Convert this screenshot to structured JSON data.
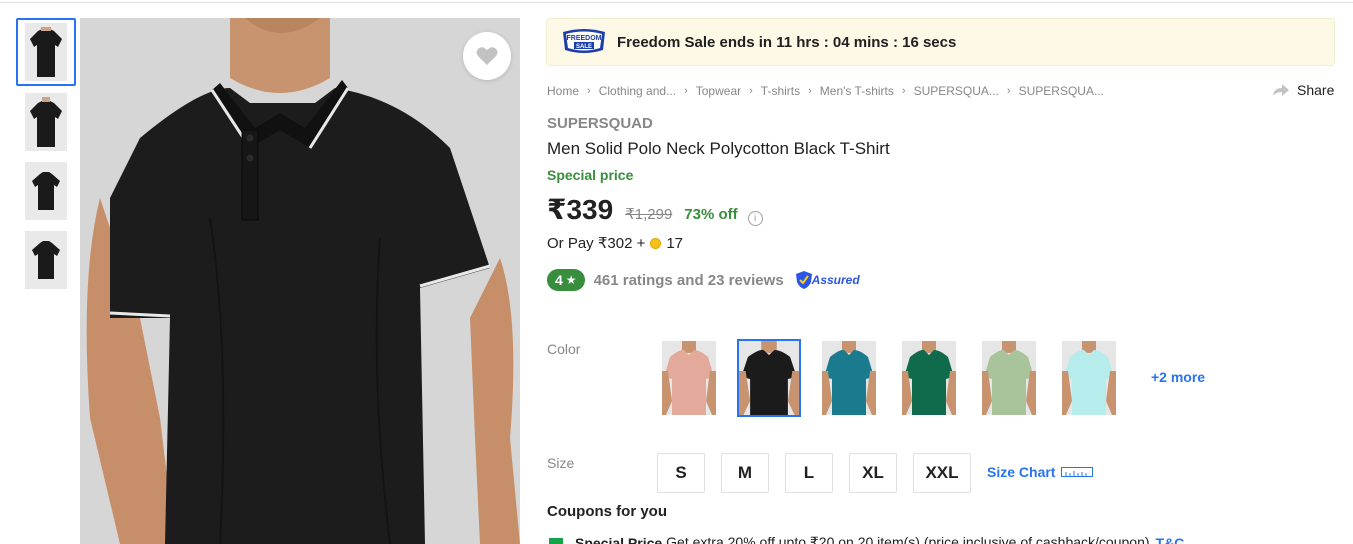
{
  "sale": {
    "logo_line1": "FREEDOM",
    "logo_line2": "SALE",
    "text": "Freedom Sale ends in 11 hrs : 04 mins : 16 secs"
  },
  "breadcrumb": [
    "Home",
    "Clothing and...",
    "Topwear",
    "T-shirts",
    "Men's T-shirts",
    "SUPERSQUA...",
    "SUPERSQUA..."
  ],
  "share_label": "Share",
  "product": {
    "brand": "SUPERSQUAD",
    "title": "Men Solid Polo Neck Polycotton Black T-Shirt",
    "special_label": "Special price",
    "price": "₹339",
    "mrp": "₹1,299",
    "discount": "73% off",
    "or_pay_prefix": "Or Pay ₹302 +",
    "or_pay_coins": "17",
    "rating": "4",
    "rating_text": "461 ratings and 23 reviews",
    "assured_label": "Assured"
  },
  "color": {
    "label": "Color",
    "swatches": [
      {
        "name": "peach",
        "color": "#e3a99a",
        "selected": false
      },
      {
        "name": "black",
        "color": "#1b1b1b",
        "selected": true
      },
      {
        "name": "teal",
        "color": "#1a7b8f",
        "selected": false
      },
      {
        "name": "green",
        "color": "#0f6b4c",
        "selected": false
      },
      {
        "name": "sage",
        "color": "#a9c39a",
        "selected": false
      },
      {
        "name": "aqua",
        "color": "#b7ecec",
        "selected": false
      }
    ],
    "more": "+2 more"
  },
  "size": {
    "label": "Size",
    "options": [
      "S",
      "M",
      "L",
      "XL",
      "XXL"
    ],
    "chart_label": "Size Chart"
  },
  "coupons": {
    "title": "Coupons for you",
    "line_bold": "Special Price",
    "line_text": "Get extra 20% off upto ₹20 on 20 item(s) (price inclusive of cashback/coupon)",
    "tc": "T&C"
  },
  "colors": {
    "accent": "#2874f0",
    "green": "#388e3c",
    "muted": "#878787",
    "banner_bg": "#fdf9e6"
  },
  "icons": [
    "heart-icon",
    "share-arrow-icon",
    "info-icon",
    "coin-icon",
    "star-icon",
    "assured-shield-icon",
    "ruler-icon",
    "chevron-right-icon"
  ]
}
